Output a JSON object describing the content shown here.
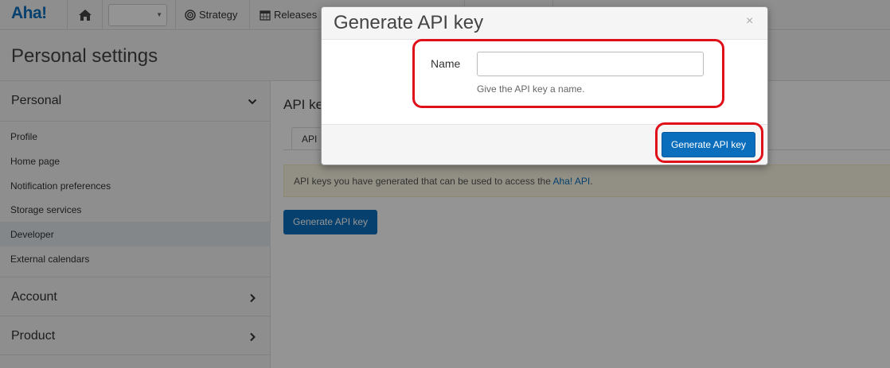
{
  "app": {
    "logo": "Aha!",
    "nav": {
      "workspace_value": "",
      "strategy": "Strategy",
      "releases": "Releases"
    }
  },
  "page": {
    "title": "Personal settings"
  },
  "sidebar": {
    "sections": [
      {
        "label": "Personal",
        "expanded": true,
        "items": [
          {
            "label": "Profile",
            "active": false
          },
          {
            "label": "Home page",
            "active": false
          },
          {
            "label": "Notification preferences",
            "active": false
          },
          {
            "label": "Storage services",
            "active": false
          },
          {
            "label": "Developer",
            "active": true
          },
          {
            "label": "External calendars",
            "active": false
          }
        ]
      },
      {
        "label": "Account",
        "expanded": false
      },
      {
        "label": "Product",
        "expanded": false
      }
    ]
  },
  "main": {
    "title": "API ke",
    "tab_label": "API",
    "info_text": "API keys you have generated that can be used to access the ",
    "info_link": "Aha! API",
    "info_suffix": ".",
    "button": "Generate API key"
  },
  "modal": {
    "title": "Generate API key",
    "close": "×",
    "name_label": "Name",
    "name_value": "",
    "name_placeholder": "",
    "help": "Give the API key a name.",
    "submit": "Generate API key"
  },
  "colors": {
    "brand": "#0a6ebd",
    "highlight": "#e0101a",
    "info_bg": "#fcf8e3",
    "active_item": "#e4e8ee"
  },
  "icons": {
    "home": "home-icon",
    "workspace_caret": "caret-down-icon",
    "strategy": "target-icon",
    "releases": "calendar-icon",
    "close": "close-icon",
    "expanded": "chevron-down-icon",
    "collapsed": "chevron-right-icon"
  }
}
